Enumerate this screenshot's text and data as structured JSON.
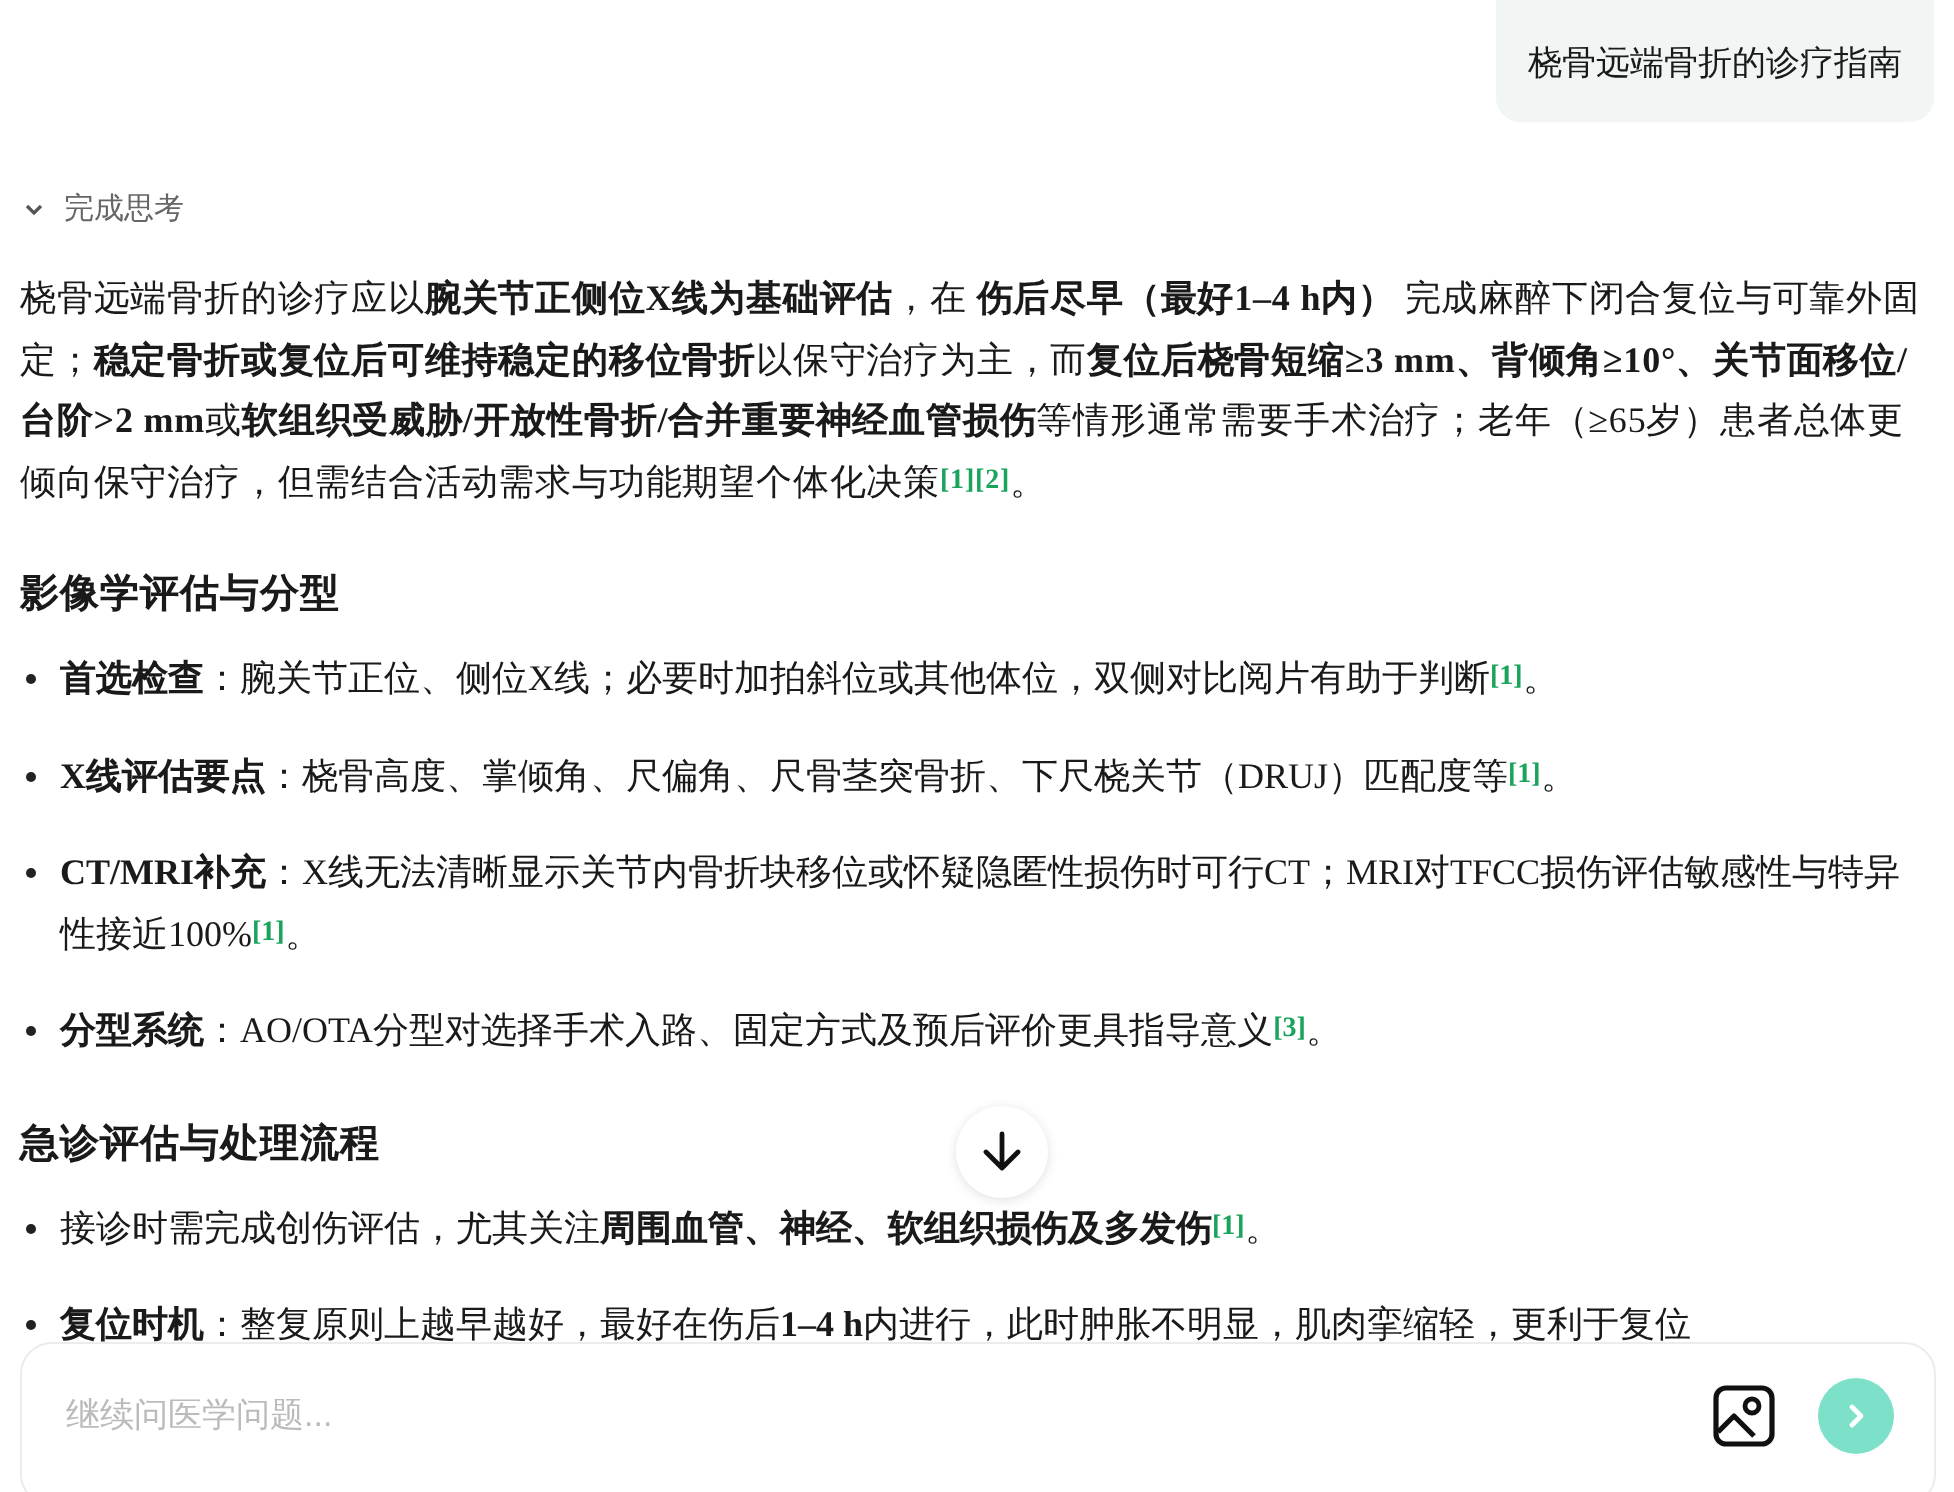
{
  "user_message": "桡骨远端骨折的诊疗指南",
  "thinking": {
    "label": "完成思考",
    "expanded": false
  },
  "answer": {
    "intro": {
      "text": "桡骨远端骨折的诊疗应以**腕关节正侧位X线为基础评估**，在 **伤后尽早（最好1–4 h内）** 完成麻醉下闭合复位与可靠外固定；**稳定骨折或复位后可维持稳定的移位骨折**以保守治疗为主，而**复位后桡骨短缩≥3 mm、背倾角≥10°、关节面移位/台阶>2 mm**或**软组织受威胁/开放性骨折/合并重要神经血管损伤**等情形通常需要手术治疗；老年（≥65岁）患者总体更倾向保守治疗，但需结合活动需求与功能期望个体化决策",
      "citations": [
        "[1]",
        "[2]"
      ],
      "end": "。"
    },
    "sections": [
      {
        "heading": "影像学评估与分型",
        "items": [
          {
            "text": "**首选检查**：腕关节正位、侧位X线；必要时加拍斜位或其他体位，双侧对比阅片有助于判断",
            "citations": [
              "[1]"
            ],
            "end": "。"
          },
          {
            "text": "**X线评估要点**：桡骨高度、掌倾角、尺偏角、尺骨茎突骨折、下尺桡关节（DRUJ）匹配度等",
            "citations": [
              "[1]"
            ],
            "end": "。"
          },
          {
            "text": "**CT/MRI补充**：X线无法清晰显示关节内骨折块移位或怀疑隐匿性损伤时可行CT；MRI对TFCC损伤评估敏感性与特异性接近100%",
            "citations": [
              "[1]"
            ],
            "end": "。"
          },
          {
            "text": "**分型系统**：AO/OTA分型对选择手术入路、固定方式及预后评价更具指导意义",
            "citations": [
              "[3]"
            ],
            "end": "。"
          }
        ]
      },
      {
        "heading": "急诊评估与处理流程",
        "items": [
          {
            "text": "接诊时需完成创伤评估，尤其关注**周围血管、神经、软组织损伤及多发伤**",
            "citations": [
              "[1]"
            ],
            "end": "。"
          },
          {
            "text": "**复位时机**：整复原则上越早越好，最好在伤后**1–4 h**内进行，此时肿胀不明显，肌肉挛缩轻，更利于复位"
          }
        ]
      }
    ]
  },
  "input": {
    "placeholder": "继续问医学问题..."
  }
}
